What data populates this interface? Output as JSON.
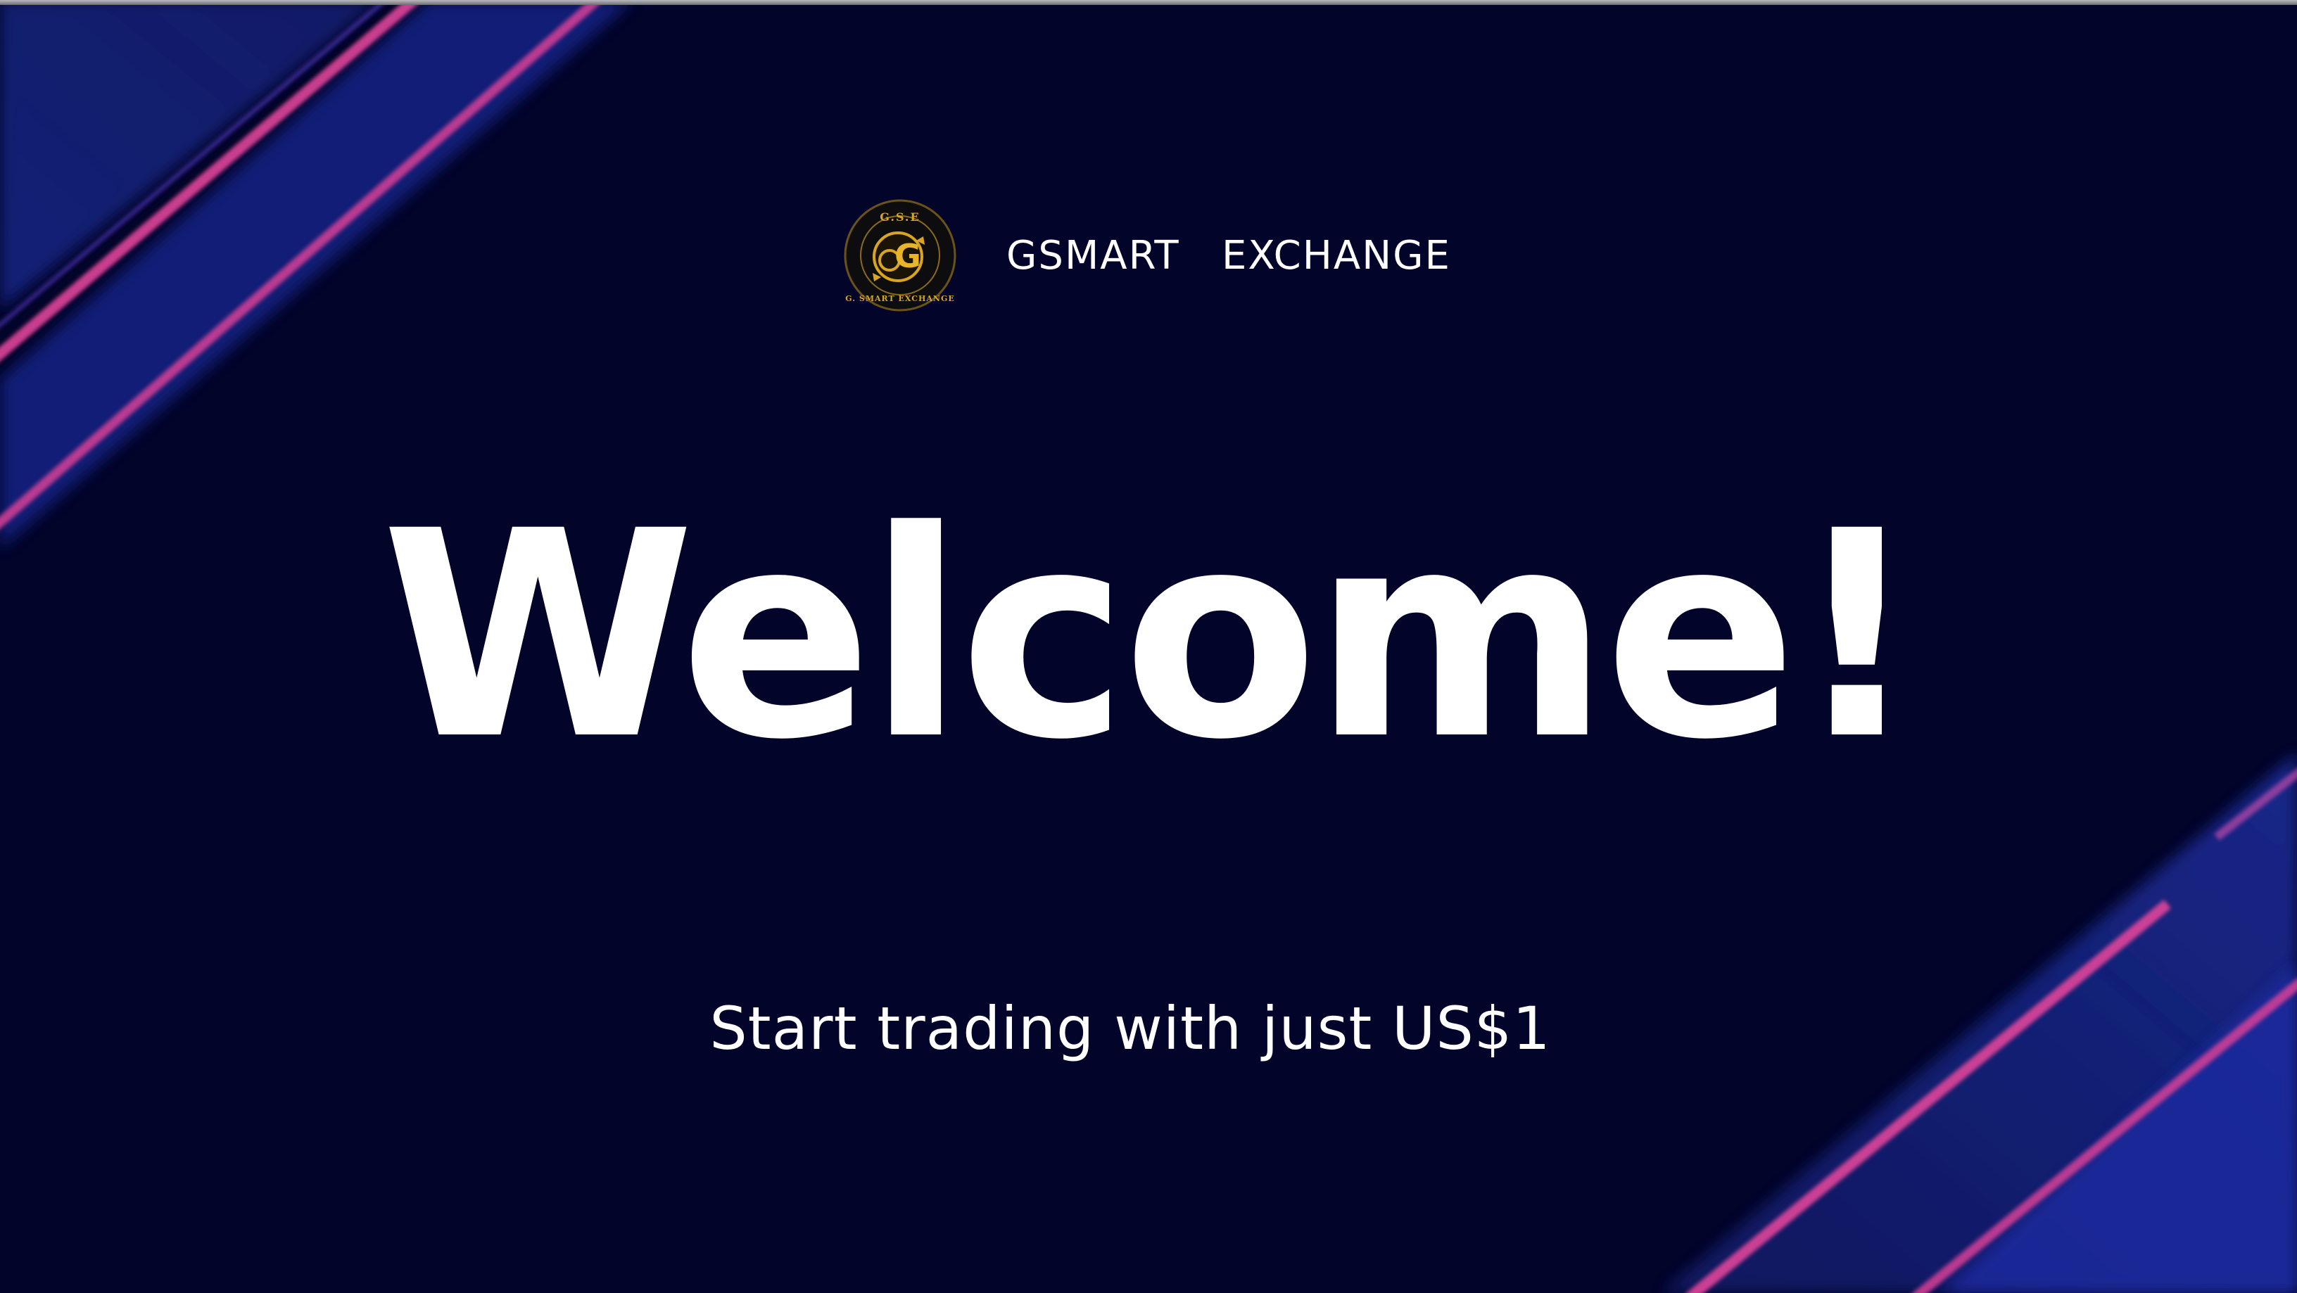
{
  "brand": {
    "name": "GSMART   EXCHANGE",
    "logo_text_top": "G.S.E",
    "logo_text_ring": "G. SMART   EXCHANGE",
    "logo_monogram": "G"
  },
  "hero": {
    "title": "Welcome!",
    "subtitle": "Start trading with just US$1"
  },
  "colors": {
    "background": "#03042a",
    "stripe_blue": "#1a2a8f",
    "stripe_pink": "#e0449a",
    "text": "#ffffff",
    "logo_gold": "#d9a521"
  },
  "icons": {
    "logo": "gse-coin-logo-icon"
  }
}
